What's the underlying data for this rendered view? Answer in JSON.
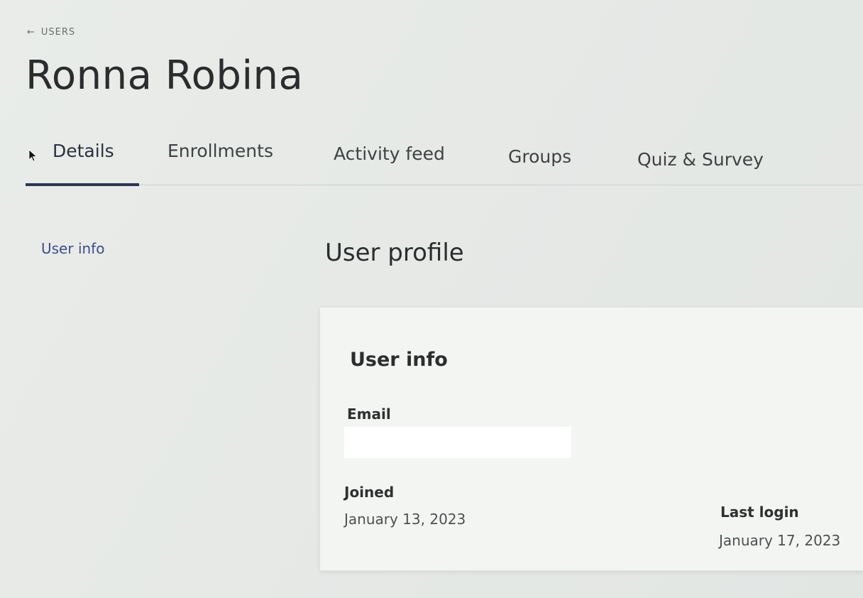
{
  "breadcrumb": {
    "label": "USERS",
    "icon": "back-arrow-icon",
    "glyph": "←"
  },
  "page": {
    "title": "Ronna Robina"
  },
  "tabs": [
    {
      "label": "Details",
      "active": true
    },
    {
      "label": "Enrollments",
      "active": false
    },
    {
      "label": "Activity feed",
      "active": false
    },
    {
      "label": "Groups",
      "active": false
    },
    {
      "label": "Quiz & Survey",
      "active": false
    }
  ],
  "sidebar": {
    "user_info_link": "User info"
  },
  "main": {
    "section_title": "User profile",
    "card": {
      "title": "User info",
      "email_label": "Email",
      "email_value": "",
      "joined_label": "Joined",
      "joined_value": "January 13, 2023",
      "last_login_label": "Last login",
      "last_login_value": "January 17, 2023"
    }
  },
  "colors": {
    "accent": "#2d3350",
    "link": "#3f4c8a"
  }
}
